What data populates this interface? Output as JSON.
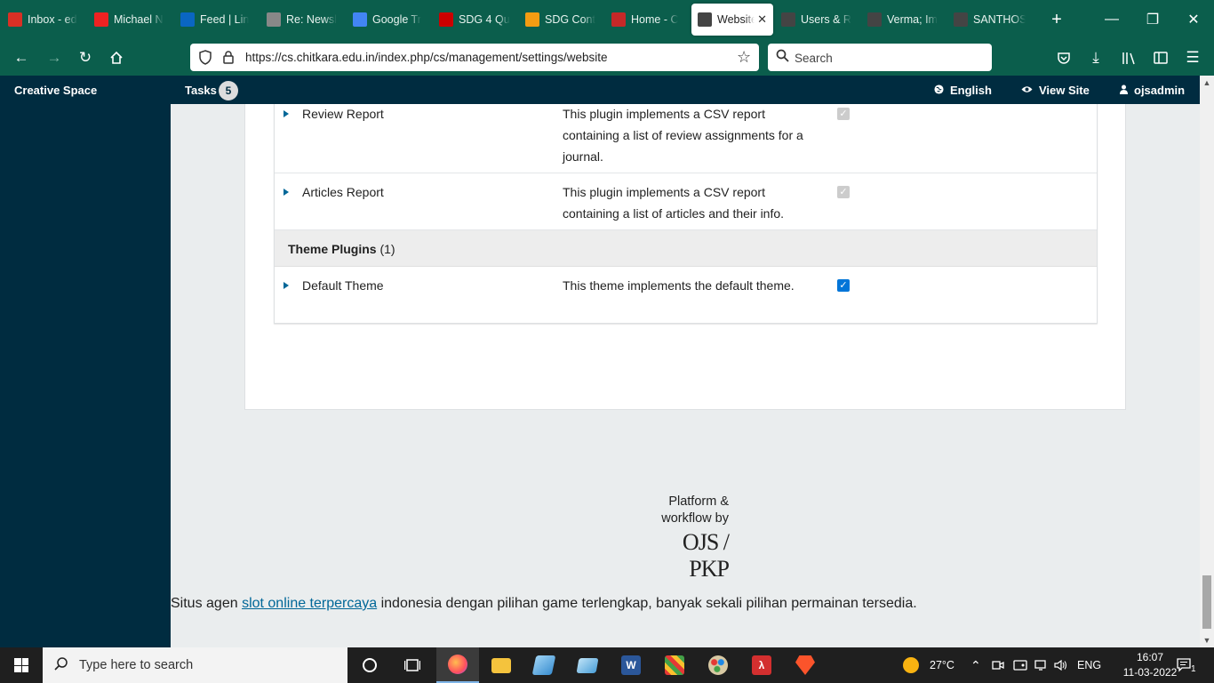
{
  "browser": {
    "tabs": [
      {
        "title": "Inbox - ed",
        "icon": "gmail-icon",
        "color": "#d93025"
      },
      {
        "title": "Michael N",
        "icon": "t-logo-icon",
        "color": "#e22"
      },
      {
        "title": "Feed | Lin",
        "icon": "linkedin-icon",
        "color": "#0a66c2"
      },
      {
        "title": "Re: Newsl",
        "icon": "mail-icon",
        "color": "#888"
      },
      {
        "title": "Google Tr",
        "icon": "google-translate-icon",
        "color": "#4285f4"
      },
      {
        "title": "SDG 4 Qu",
        "icon": "sn-icon",
        "color": "#c00"
      },
      {
        "title": "SDG Cont",
        "icon": "rss-icon",
        "color": "#f39c12"
      },
      {
        "title": "Home - C",
        "icon": "site-icon",
        "color": "#c62828"
      },
      {
        "title": "Website",
        "icon": "pkp-icon",
        "color": "#444",
        "active": true
      },
      {
        "title": "Users & R",
        "icon": "pkp-icon",
        "color": "#444"
      },
      {
        "title": "Verma; Im",
        "icon": "pkp-icon",
        "color": "#444"
      },
      {
        "title": "SANTHOS",
        "icon": "pkp-icon",
        "color": "#444"
      }
    ],
    "active_tab_close": "✕",
    "url": "https://cs.chitkara.edu.in/index.php/cs/management/settings/website",
    "search_placeholder": "Search"
  },
  "app": {
    "brand": "Creative Space",
    "tasks_label": "Tasks",
    "tasks_count": "5",
    "language": "English",
    "view_site": "View Site",
    "user": "ojsadmin"
  },
  "plugins": {
    "rows_top": [
      {
        "name": "Review Report",
        "desc": "This plugin implements a CSV report containing a list of review assignments for a journal.",
        "enabled": true,
        "disabled": true
      },
      {
        "name": "Articles Report",
        "desc": "This plugin implements a CSV report containing a list of articles and their info.",
        "enabled": true,
        "disabled": true
      }
    ],
    "category": {
      "title": "Theme Plugins",
      "count": "(1)"
    },
    "rows_theme": [
      {
        "name": "Default Theme",
        "desc": "This theme implements the default theme.",
        "enabled": true,
        "disabled": false
      }
    ]
  },
  "footer": {
    "platform_line1": "Platform &",
    "platform_line2": "workflow by",
    "logo_text": "OJS / PKP",
    "promo_before": "Situs agen ",
    "promo_link": "slot online terpercaya",
    "promo_after": " indonesia dengan pilihan game terlengkap, banyak sekali pilihan permainan tersedia."
  },
  "taskbar": {
    "search_placeholder": "Type here to search",
    "weather": "27°C",
    "language": "ENG",
    "time": "16:07",
    "date": "11-03-2022",
    "notifications": "1"
  }
}
